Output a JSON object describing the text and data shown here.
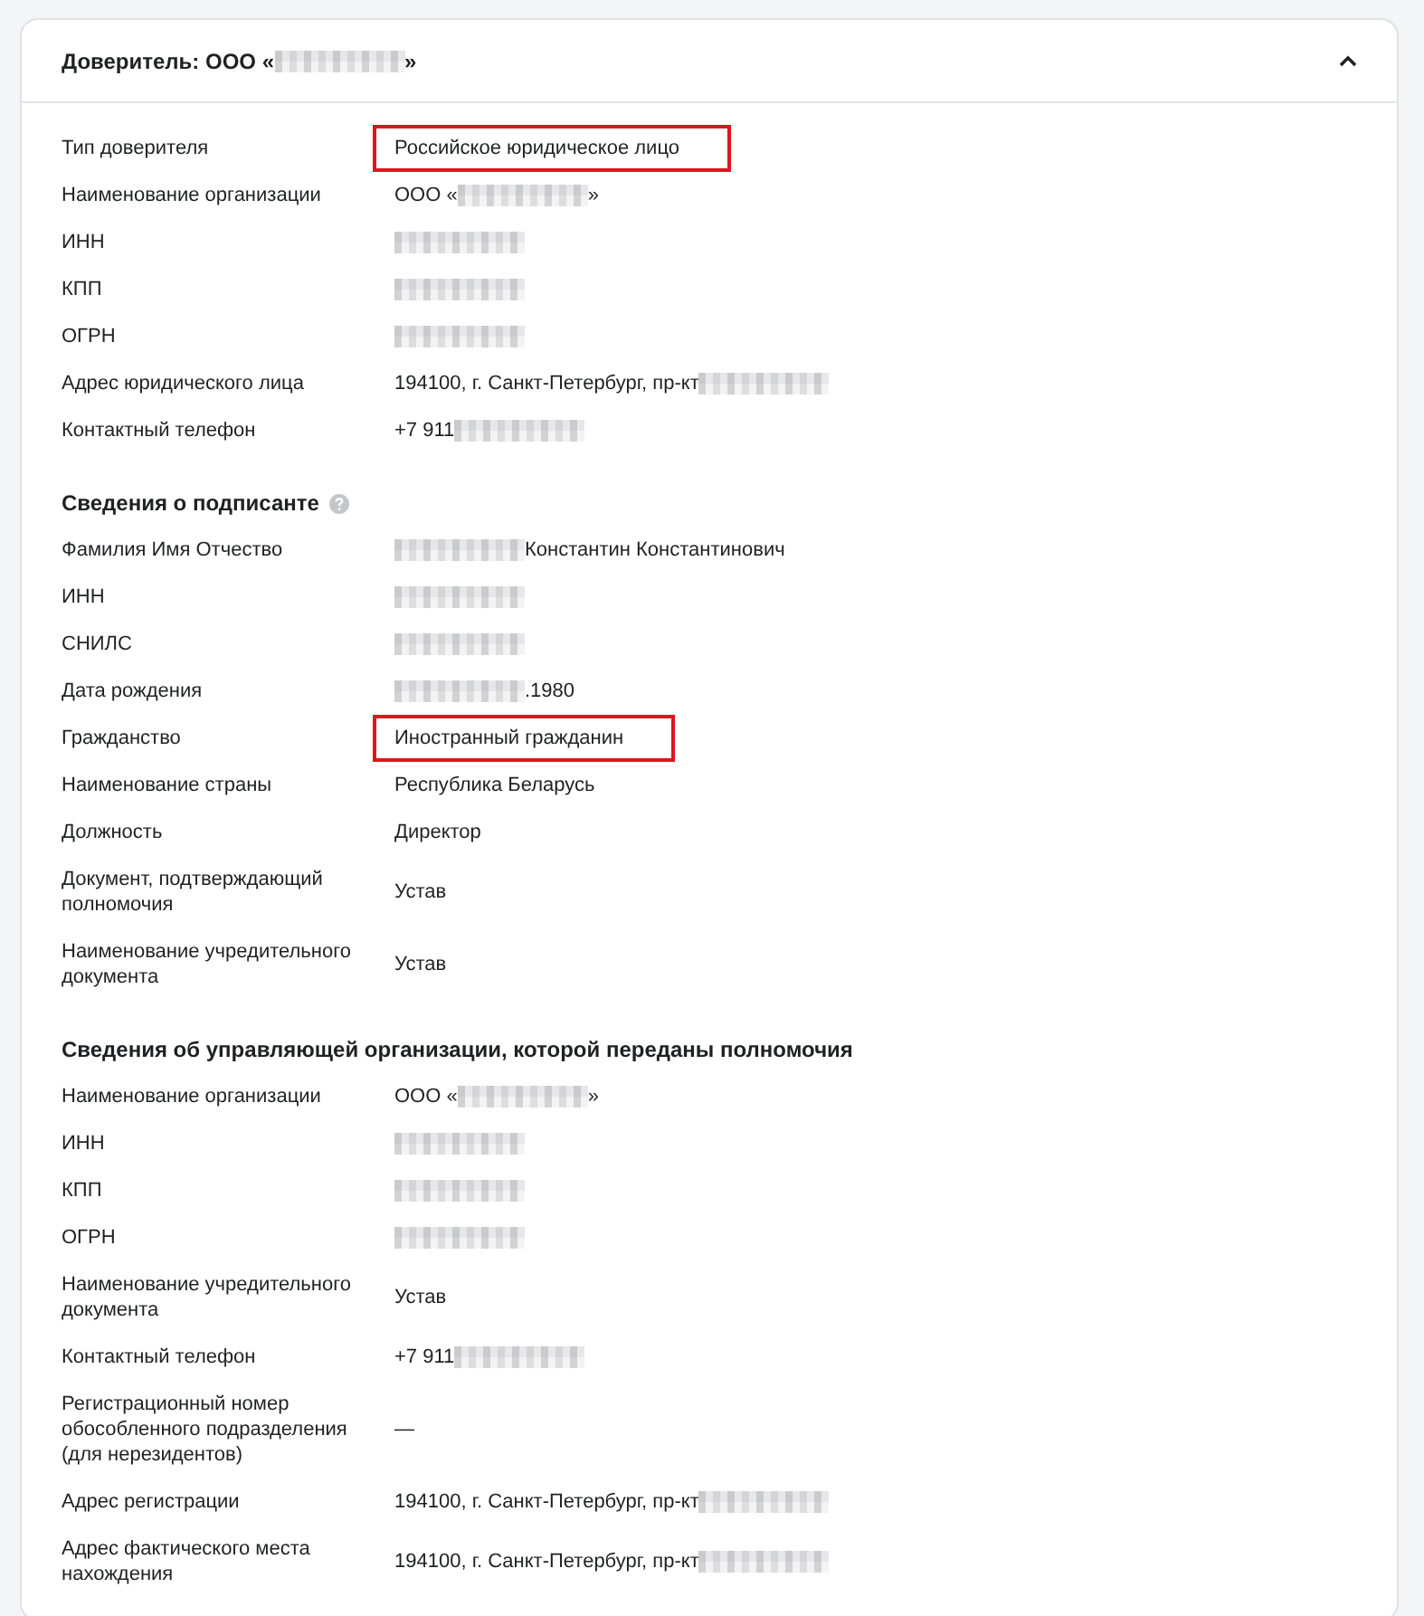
{
  "panel": {
    "title": [
      {
        "kind": "text",
        "text": "Доверитель: ООО «"
      },
      {
        "kind": "redacted"
      },
      {
        "kind": "text",
        "text": "»"
      }
    ],
    "expanded": true
  },
  "sections": [
    {
      "rows": [
        {
          "label": "Тип доверителя",
          "highlighted": true,
          "value": [
            {
              "kind": "text",
              "text": "Российское юридическое лицо"
            }
          ]
        },
        {
          "label": "Наименование организации",
          "highlighted": false,
          "value": [
            {
              "kind": "text",
              "text": "ООО «"
            },
            {
              "kind": "redacted"
            },
            {
              "kind": "text",
              "text": "»"
            }
          ]
        },
        {
          "label": "ИНН",
          "highlighted": false,
          "value": [
            {
              "kind": "redacted"
            }
          ]
        },
        {
          "label": "КПП",
          "highlighted": false,
          "value": [
            {
              "kind": "redacted"
            }
          ]
        },
        {
          "label": "ОГРН",
          "highlighted": false,
          "value": [
            {
              "kind": "redacted"
            }
          ]
        },
        {
          "label": "Адрес юридического лица",
          "highlighted": false,
          "value": [
            {
              "kind": "text",
              "text": "194100, г. Санкт-Петербург, пр-кт"
            },
            {
              "kind": "redacted"
            }
          ]
        },
        {
          "label": "Контактный телефон",
          "highlighted": false,
          "value": [
            {
              "kind": "text",
              "text": "+7 911"
            },
            {
              "kind": "redacted"
            }
          ]
        }
      ]
    },
    {
      "heading": "Сведения о подписанте",
      "help": true,
      "rows": [
        {
          "label": "Фамилия Имя Отчество",
          "highlighted": false,
          "value": [
            {
              "kind": "redacted"
            },
            {
              "kind": "text",
              "text": "Константин Константинович"
            }
          ]
        },
        {
          "label": "ИНН",
          "highlighted": false,
          "value": [
            {
              "kind": "redacted"
            }
          ]
        },
        {
          "label": "СНИЛС",
          "highlighted": false,
          "value": [
            {
              "kind": "redacted"
            }
          ]
        },
        {
          "label": "Дата рождения",
          "highlighted": false,
          "value": [
            {
              "kind": "redacted"
            },
            {
              "kind": "text",
              "text": ".1980"
            }
          ]
        },
        {
          "label": "Гражданство",
          "highlighted": true,
          "value": [
            {
              "kind": "text",
              "text": "Иностранный гражданин"
            }
          ]
        },
        {
          "label": "Наименование страны",
          "highlighted": false,
          "value": [
            {
              "kind": "text",
              "text": "Республика Беларусь"
            }
          ]
        },
        {
          "label": "Должность",
          "highlighted": false,
          "value": [
            {
              "kind": "text",
              "text": "Директор"
            }
          ]
        },
        {
          "label": "Документ, подтверждающий полномочия",
          "highlighted": false,
          "value": [
            {
              "kind": "text",
              "text": "Устав"
            }
          ]
        },
        {
          "label": "Наименование учредительного документа",
          "highlighted": false,
          "value": [
            {
              "kind": "text",
              "text": "Устав"
            }
          ]
        }
      ]
    },
    {
      "heading": "Сведения об управляющей организации, которой переданы полномочия",
      "help": false,
      "rows": [
        {
          "label": "Наименование организации",
          "highlighted": false,
          "value": [
            {
              "kind": "text",
              "text": "ООО «"
            },
            {
              "kind": "redacted"
            },
            {
              "kind": "text",
              "text": "»"
            }
          ]
        },
        {
          "label": "ИНН",
          "highlighted": false,
          "value": [
            {
              "kind": "redacted"
            }
          ]
        },
        {
          "label": "КПП",
          "highlighted": false,
          "value": [
            {
              "kind": "redacted"
            }
          ]
        },
        {
          "label": "ОГРН",
          "highlighted": false,
          "value": [
            {
              "kind": "redacted"
            }
          ]
        },
        {
          "label": "Наименование учредительного документа",
          "highlighted": false,
          "value": [
            {
              "kind": "text",
              "text": "Устав"
            }
          ]
        },
        {
          "label": "Контактный телефон",
          "highlighted": false,
          "value": [
            {
              "kind": "text",
              "text": "+7 911"
            },
            {
              "kind": "redacted"
            }
          ]
        },
        {
          "label": "Регистрационный номер обособленного подразделения (для нерезидентов)",
          "highlighted": false,
          "value": [
            {
              "kind": "text",
              "text": "—"
            }
          ]
        },
        {
          "label": "Адрес регистрации",
          "highlighted": false,
          "value": [
            {
              "kind": "text",
              "text": "194100, г. Санкт-Петербург, пр-кт"
            },
            {
              "kind": "redacted"
            }
          ]
        },
        {
          "label": "Адрес фактического места нахождения",
          "highlighted": false,
          "value": [
            {
              "kind": "text",
              "text": "194100, г. Санкт-Петербург, пр-кт"
            },
            {
              "kind": "redacted"
            }
          ]
        }
      ]
    }
  ]
}
